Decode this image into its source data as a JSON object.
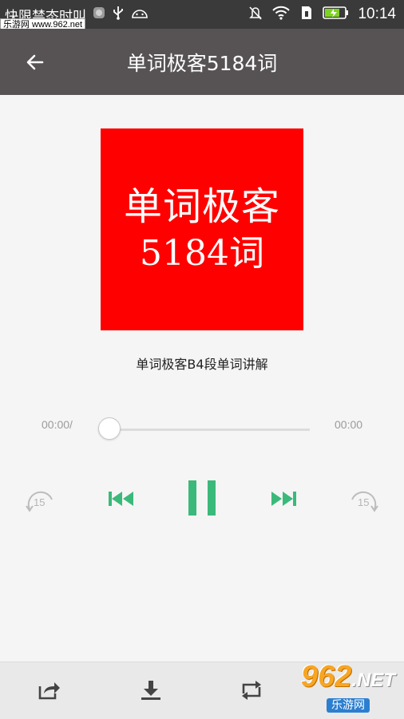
{
  "status_bar": {
    "left_text": "快限禁态时叫",
    "time": "10:14",
    "icons": [
      "notification-dot-icon",
      "usb-icon",
      "android-debug-icon",
      "mute-icon",
      "wifi-icon",
      "sim-icon",
      "battery-charging-icon"
    ]
  },
  "watermark_top": "乐游网 www.962.net",
  "header": {
    "title": "单词极客5184词"
  },
  "cover": {
    "line1": "单词极客",
    "line2": "5184词",
    "background": "#ff0000"
  },
  "track": {
    "title": "单词极客B4段单词讲解"
  },
  "player": {
    "current_time": "00:00/",
    "total_time": "00:00",
    "progress": 0,
    "skip_back_seconds": "15",
    "skip_forward_seconds": "15",
    "accent_color": "#3bb97a"
  },
  "bottom_bar": {
    "icons": [
      "share-icon",
      "download-icon",
      "repeat-icon"
    ]
  },
  "watermark_bottom": {
    "logo": "962",
    "logo_suffix": ".NET",
    "sub": "乐游网"
  }
}
